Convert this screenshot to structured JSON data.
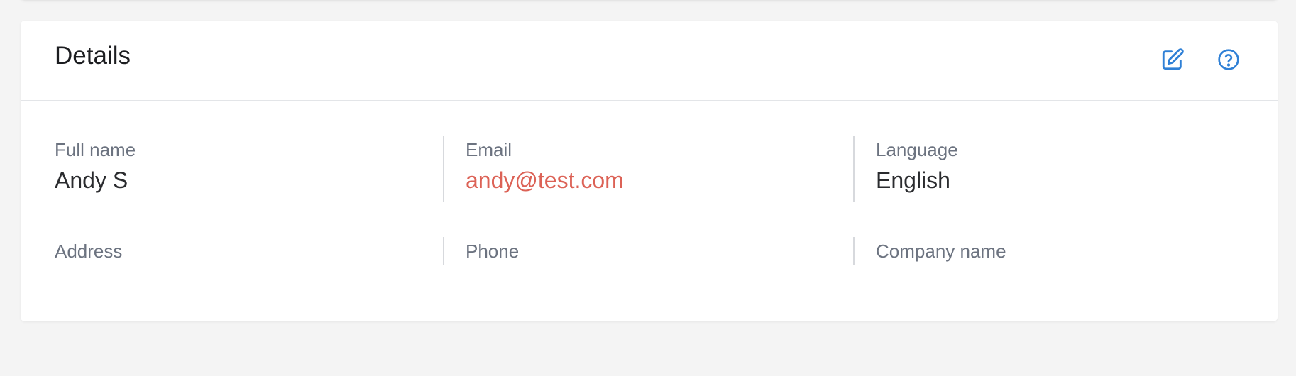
{
  "details_card": {
    "title": "Details",
    "actions": {
      "edit_icon": "edit-icon",
      "help_icon": "help-circle-icon",
      "icon_color": "#2f80d6"
    },
    "fields": {
      "full_name": {
        "label": "Full name",
        "value": "Andy S"
      },
      "email": {
        "label": "Email",
        "value": "andy@test.com",
        "color": "#dc6256"
      },
      "language": {
        "label": "Language",
        "value": "English"
      },
      "address": {
        "label": "Address",
        "value": ""
      },
      "phone": {
        "label": "Phone",
        "value": ""
      },
      "company_name": {
        "label": "Company name",
        "value": ""
      }
    }
  }
}
